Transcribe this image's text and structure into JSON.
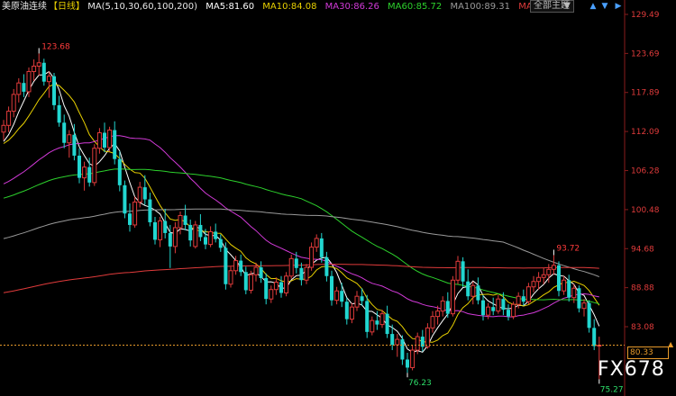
{
  "header": {
    "title": "美原油连续",
    "period": "【日线】",
    "ma_label": "MA(5,10,30,60,100,200)",
    "ma_values": [
      {
        "text": "MA5:81.60",
        "color": "#ffffff"
      },
      {
        "text": "MA10:84.08",
        "color": "#e8d000"
      },
      {
        "text": "MA30:86.26",
        "color": "#d23ad8"
      },
      {
        "text": "MA60:85.72",
        "color": "#2cd02c"
      },
      {
        "text": "MA100:89.31",
        "color": "#9a9a9a"
      },
      {
        "text": "MA200:98.0",
        "color": "#e03b3b"
      }
    ]
  },
  "toolbar": {
    "dropdown_label": "全部主题",
    "dropdown_caret": "▼",
    "ctl_up": "▲",
    "ctl_down": "▼",
    "ctl_right": "▶"
  },
  "chart_data": {
    "type": "candlestick",
    "ylim": [
      75.0,
      130.5
    ],
    "y_ticks": [
      129.49,
      123.69,
      117.89,
      112.09,
      106.28,
      100.48,
      94.68,
      88.88,
      83.08
    ],
    "current_price": 80.33,
    "annotations": [
      {
        "label": "123.68",
        "index": 7,
        "value": 123.68,
        "position": "above"
      },
      {
        "label": "93.72",
        "index": 109,
        "value": 93.72,
        "position": "above"
      },
      {
        "label": "76.23",
        "index": 80,
        "value": 76.23,
        "position": "below"
      },
      {
        "label": "75.27",
        "index": 118,
        "value": 75.27,
        "position": "below"
      }
    ],
    "up_color": "#e03b3b",
    "down_color": "#22d6d0",
    "candles": [
      [
        112.0,
        113.8,
        110.8,
        113.0
      ],
      [
        113.0,
        115.8,
        112.0,
        115.1
      ],
      [
        115.1,
        118.4,
        114.2,
        117.6
      ],
      [
        117.6,
        120.0,
        116.4,
        119.3
      ],
      [
        119.3,
        120.6,
        117.2,
        118.0
      ],
      [
        118.0,
        121.6,
        117.2,
        121.0
      ],
      [
        121.0,
        122.8,
        119.6,
        121.8
      ],
      [
        121.8,
        123.68,
        120.4,
        122.3
      ],
      [
        122.3,
        122.9,
        118.9,
        119.5
      ],
      [
        119.5,
        121.0,
        117.1,
        120.3
      ],
      [
        120.3,
        120.8,
        115.3,
        116.0
      ],
      [
        116.0,
        117.4,
        112.8,
        113.4
      ],
      [
        113.4,
        114.6,
        109.6,
        110.4
      ],
      [
        110.4,
        112.3,
        108.2,
        111.6
      ],
      [
        111.6,
        113.2,
        107.8,
        108.5
      ],
      [
        108.5,
        109.6,
        104.4,
        105.2
      ],
      [
        105.2,
        107.6,
        103.3,
        106.8
      ],
      [
        106.8,
        108.2,
        103.9,
        104.5
      ],
      [
        104.5,
        110.2,
        104.0,
        109.6
      ],
      [
        109.6,
        112.6,
        108.8,
        111.9
      ],
      [
        111.9,
        113.4,
        109.0,
        109.7
      ],
      [
        109.7,
        112.8,
        109.1,
        112.3
      ],
      [
        112.3,
        113.6,
        107.2,
        108.0
      ],
      [
        108.0,
        109.2,
        103.2,
        104.1
      ],
      [
        104.1,
        104.8,
        99.2,
        99.9
      ],
      [
        99.9,
        101.4,
        97.2,
        98.2
      ],
      [
        98.2,
        102.4,
        97.8,
        101.6
      ],
      [
        101.6,
        104.6,
        100.8,
        103.8
      ],
      [
        103.8,
        105.6,
        101.2,
        102.0
      ],
      [
        102.0,
        103.0,
        98.0,
        98.6
      ],
      [
        98.6,
        99.4,
        95.3,
        96.0
      ],
      [
        96.0,
        99.4,
        94.9,
        98.8
      ],
      [
        98.8,
        100.6,
        96.2,
        97.0
      ],
      [
        97.0,
        98.2,
        91.8,
        95.0
      ],
      [
        95.0,
        98.6,
        94.0,
        97.8
      ],
      [
        97.8,
        100.2,
        96.8,
        99.6
      ],
      [
        99.6,
        101.2,
        97.4,
        98.2
      ],
      [
        98.2,
        99.0,
        95.0,
        95.9
      ],
      [
        95.0,
        98.8,
        94.7,
        98.2
      ],
      [
        98.2,
        99.8,
        95.8,
        96.4
      ],
      [
        96.4,
        97.6,
        94.6,
        95.3
      ],
      [
        95.3,
        98.0,
        94.9,
        97.2
      ],
      [
        97.2,
        98.4,
        95.6,
        96.1
      ],
      [
        96.1,
        96.8,
        94.2,
        94.8
      ],
      [
        94.8,
        95.6,
        88.6,
        89.4
      ],
      [
        89.4,
        92.0,
        88.9,
        91.4
      ],
      [
        91.4,
        93.6,
        90.8,
        92.9
      ],
      [
        92.9,
        93.8,
        90.6,
        91.2
      ],
      [
        91.2,
        92.0,
        87.9,
        88.5
      ],
      [
        88.5,
        91.4,
        88.0,
        90.8
      ],
      [
        90.8,
        92.6,
        89.8,
        91.9
      ],
      [
        91.9,
        92.8,
        89.6,
        90.3
      ],
      [
        90.3,
        91.0,
        86.4,
        87.2
      ],
      [
        87.2,
        89.2,
        86.6,
        88.6
      ],
      [
        88.6,
        90.4,
        87.8,
        89.7
      ],
      [
        89.7,
        90.6,
        87.4,
        88.1
      ],
      [
        88.1,
        91.2,
        87.6,
        90.6
      ],
      [
        90.6,
        93.8,
        90.2,
        93.2
      ],
      [
        93.2,
        94.2,
        91.0,
        91.8
      ],
      [
        91.8,
        92.6,
        89.2,
        90.0
      ],
      [
        90.0,
        92.4,
        89.4,
        91.9
      ],
      [
        91.9,
        95.6,
        91.4,
        94.9
      ],
      [
        94.9,
        96.8,
        94.2,
        96.2
      ],
      [
        96.2,
        97.0,
        92.6,
        93.4
      ],
      [
        93.4,
        94.2,
        89.8,
        90.6
      ],
      [
        90.6,
        91.4,
        86.2,
        87.0
      ],
      [
        87.0,
        89.0,
        86.4,
        88.4
      ],
      [
        88.4,
        89.6,
        86.0,
        86.8
      ],
      [
        86.8,
        87.4,
        83.4,
        84.2
      ],
      [
        84.2,
        86.6,
        83.6,
        86.0
      ],
      [
        86.0,
        88.4,
        85.4,
        87.6
      ],
      [
        87.6,
        88.8,
        86.2,
        86.9
      ],
      [
        86.9,
        87.8,
        81.4,
        82.3
      ],
      [
        82.3,
        84.6,
        81.8,
        84.0
      ],
      [
        84.0,
        85.4,
        82.6,
        83.4
      ],
      [
        83.4,
        85.6,
        82.9,
        85.0
      ],
      [
        85.0,
        86.2,
        81.4,
        82.0
      ],
      [
        82.0,
        83.4,
        79.6,
        80.4
      ],
      [
        80.4,
        82.0,
        78.6,
        81.2
      ],
      [
        81.2,
        81.8,
        77.4,
        78.2
      ],
      [
        78.2,
        79.2,
        76.23,
        77.0
      ],
      [
        77.0,
        80.4,
        76.6,
        79.6
      ],
      [
        79.6,
        82.2,
        79.0,
        81.6
      ],
      [
        81.6,
        82.6,
        79.4,
        80.1
      ],
      [
        80.1,
        83.6,
        79.8,
        82.9
      ],
      [
        82.9,
        85.4,
        82.2,
        84.6
      ],
      [
        84.6,
        86.2,
        83.4,
        85.4
      ],
      [
        85.4,
        87.6,
        84.6,
        86.9
      ],
      [
        86.9,
        88.2,
        84.4,
        85.0
      ],
      [
        85.0,
        90.6,
        84.6,
        90.0
      ],
      [
        90.0,
        93.6,
        89.4,
        92.8
      ],
      [
        92.8,
        93.4,
        89.0,
        89.8
      ],
      [
        89.8,
        91.6,
        87.0,
        87.6
      ],
      [
        87.6,
        89.8,
        86.4,
        89.2
      ],
      [
        89.2,
        90.4,
        86.4,
        87.0
      ],
      [
        87.0,
        87.8,
        84.0,
        84.8
      ],
      [
        84.8,
        86.6,
        84.2,
        86.0
      ],
      [
        86.0,
        87.4,
        84.8,
        85.4
      ],
      [
        85.4,
        87.8,
        85.0,
        87.2
      ],
      [
        87.2,
        88.2,
        84.8,
        85.6
      ],
      [
        85.6,
        86.4,
        84.0,
        84.6
      ],
      [
        84.6,
        86.8,
        84.2,
        86.4
      ],
      [
        86.4,
        88.2,
        85.8,
        87.6
      ],
      [
        87.6,
        88.6,
        86.2,
        86.8
      ],
      [
        86.8,
        89.6,
        86.4,
        89.0
      ],
      [
        89.0,
        90.6,
        88.2,
        89.8
      ],
      [
        89.8,
        91.2,
        88.6,
        90.4
      ],
      [
        90.4,
        91.8,
        89.4,
        90.8
      ],
      [
        90.8,
        92.4,
        89.6,
        91.6
      ],
      [
        91.6,
        93.72,
        90.8,
        92.2
      ],
      [
        92.2,
        92.8,
        87.6,
        88.4
      ],
      [
        88.4,
        90.6,
        87.8,
        90.0
      ],
      [
        90.0,
        90.8,
        86.8,
        87.4
      ],
      [
        87.4,
        89.4,
        86.6,
        88.8
      ],
      [
        88.8,
        89.2,
        85.2,
        85.8
      ],
      [
        85.8,
        87.2,
        84.6,
        86.6
      ],
      [
        86.6,
        87.0,
        82.2,
        82.9
      ],
      [
        82.9,
        84.2,
        79.6,
        80.2
      ],
      [
        80.2,
        81.6,
        75.27,
        80.33
      ]
    ]
  }
}
